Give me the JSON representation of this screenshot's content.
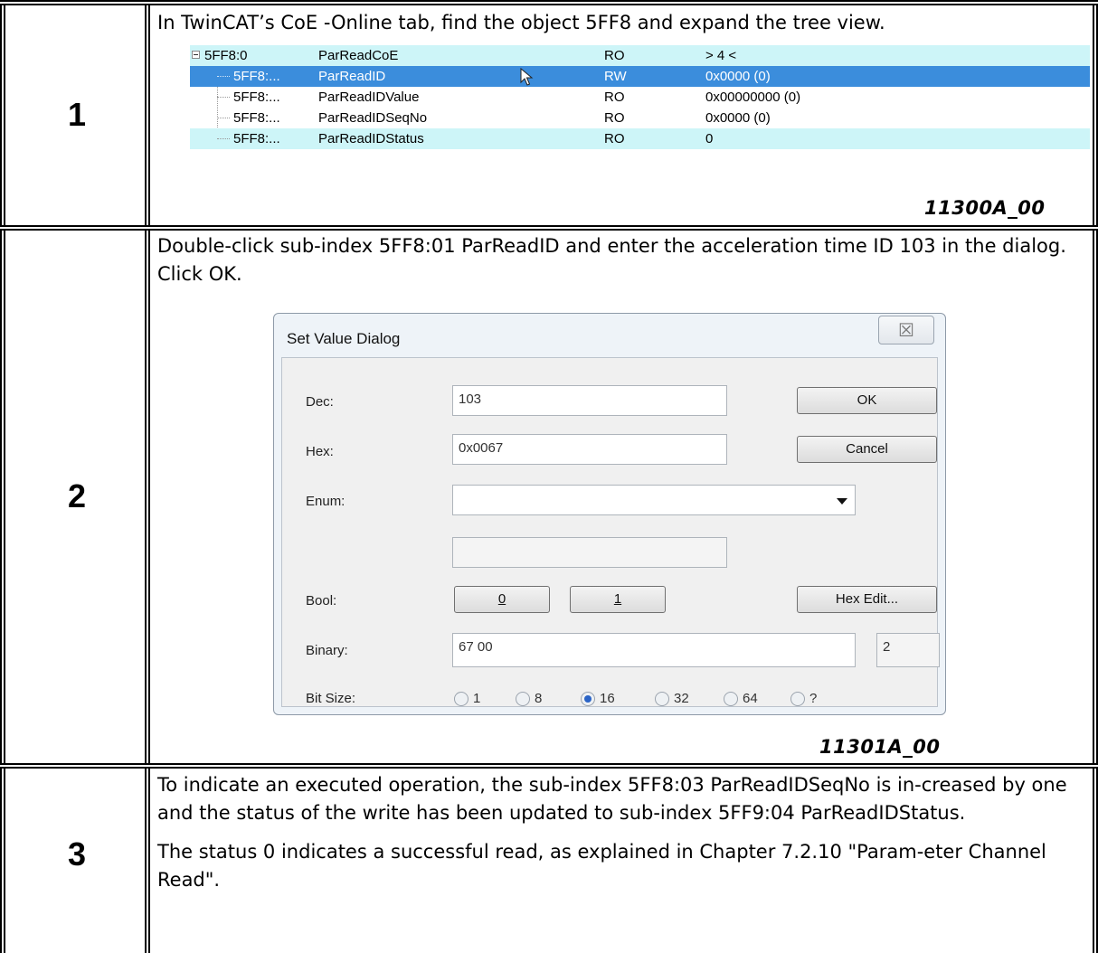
{
  "steps": [
    {
      "number": "1",
      "text": "In TwinCAT’s CoE -Online tab, find the object 5FF8 and expand the tree view.",
      "figure_id": "11300A_00"
    },
    {
      "number": "2",
      "text": "Double-click sub-index 5FF8:01 ParReadID and enter the acceleration time ID 103 in the dialog. Click OK.",
      "figure_id": "11301A_00"
    },
    {
      "number": "3",
      "paragraphs": [
        "To indicate an executed operation, the sub-index 5FF8:03 ParReadIDSeqNo is in-creased by one and the status of the write has been updated to sub-index 5FF9:04 ParReadIDStatus.",
        "The status 0 indicates a successful read, as explained in Chapter 7.2.10 \"Param-eter Channel Read\"."
      ]
    }
  ],
  "tree": {
    "rows": [
      {
        "index": "5FF8:0",
        "name": "ParReadCoE",
        "flags": "RO",
        "value": "> 4 <"
      },
      {
        "index": "5FF8:...",
        "name": "ParReadID",
        "flags": "RW",
        "value": "0x0000 (0)"
      },
      {
        "index": "5FF8:...",
        "name": "ParReadIDValue",
        "flags": "RO",
        "value": "0x00000000 (0)"
      },
      {
        "index": "5FF8:...",
        "name": "ParReadIDSeqNo",
        "flags": "RO",
        "value": "0x0000 (0)"
      },
      {
        "index": "5FF8:...",
        "name": "ParReadIDStatus",
        "flags": "RO",
        "value": "0"
      }
    ]
  },
  "dialog": {
    "title": "Set Value Dialog",
    "close_glyph": "☒",
    "labels": {
      "dec": "Dec:",
      "hex": "Hex:",
      "enum": "Enum:",
      "bool": "Bool:",
      "binary": "Binary:",
      "bit_size": "Bit Size:"
    },
    "values": {
      "dec": "103",
      "hex": "0x0067",
      "enum": "",
      "enum_text": "",
      "binary": "67 00",
      "binary_length": "2"
    },
    "buttons": {
      "ok": "OK",
      "cancel": "Cancel",
      "bool_0": "0",
      "bool_1": "1",
      "hex_edit": "Hex Edit..."
    },
    "bit_size_options": [
      "1",
      "8",
      "16",
      "32",
      "64",
      "?"
    ],
    "bit_size_selected": "16"
  }
}
